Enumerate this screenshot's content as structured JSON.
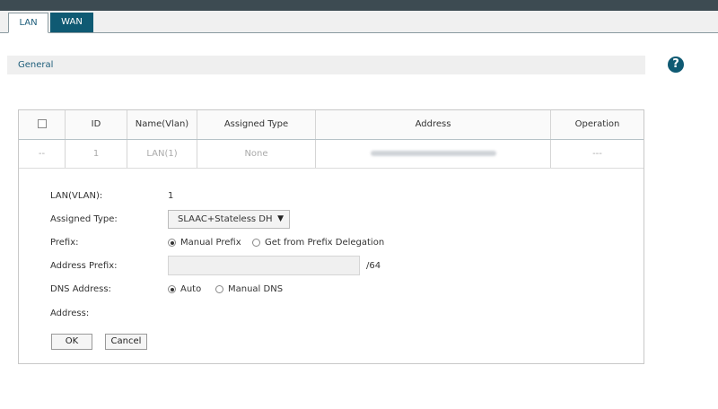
{
  "tabs": [
    {
      "label": "LAN"
    },
    {
      "label": "WAN"
    }
  ],
  "section": {
    "title": "General"
  },
  "help_icon": "question-icon",
  "table": {
    "headers": [
      "ID",
      "Name(Vlan)",
      "Assigned Type",
      "Address",
      "Operation"
    ],
    "row": {
      "select": "--",
      "id": "1",
      "name": "LAN(1)",
      "type": "None",
      "operation": "---"
    }
  },
  "form": {
    "lan_label": "LAN(VLAN):",
    "lan_value": "1",
    "assigned_type_label": "Assigned Type:",
    "assigned_type_value": "SLAAC+Stateless DHC",
    "prefix_label": "Prefix:",
    "prefix_manual": "Manual Prefix",
    "prefix_delegation": "Get from Prefix Delegation",
    "address_prefix_label": "Address Prefix:",
    "address_prefix_value": "",
    "prefix_suffix": "/64",
    "dns_label": "DNS Address:",
    "dns_auto": "Auto",
    "dns_manual": "Manual DNS",
    "address_label": "Address:",
    "ok": "OK",
    "cancel": "Cancel"
  },
  "colors": {
    "accent": "#0f5a73",
    "header_text": "#1d5d7a",
    "topbar": "#3d4b52"
  }
}
